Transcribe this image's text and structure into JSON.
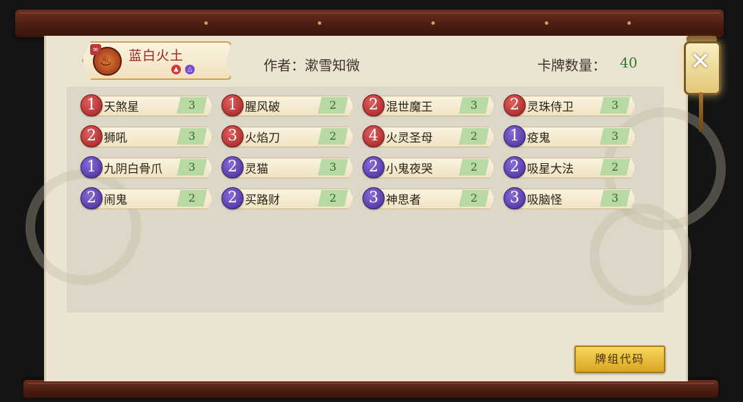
{
  "deck": {
    "name": "蓝白火土",
    "emblem": "fire-spirit-emblem",
    "elements": [
      "fire-icon",
      "earth-icon"
    ],
    "element_colors": [
      "#d23a3a",
      "#7a4ad0"
    ]
  },
  "author": {
    "label": "作者：漱雪知微"
  },
  "card_count": {
    "label": "卡牌数量：",
    "value": "40"
  },
  "cards": [
    {
      "cost": "1",
      "color": "red",
      "name": "天煞星",
      "qty": "3"
    },
    {
      "cost": "1",
      "color": "red",
      "name": "腥风破",
      "qty": "2"
    },
    {
      "cost": "2",
      "color": "red",
      "name": "混世魔王",
      "qty": "3"
    },
    {
      "cost": "2",
      "color": "red",
      "name": "灵珠侍卫",
      "qty": "3"
    },
    {
      "cost": "2",
      "color": "red",
      "name": "狮吼",
      "qty": "3"
    },
    {
      "cost": "3",
      "color": "red",
      "name": "火焰刀",
      "qty": "2"
    },
    {
      "cost": "4",
      "color": "red",
      "name": "火灵圣母",
      "qty": "2"
    },
    {
      "cost": "1",
      "color": "purple",
      "name": "疫鬼",
      "qty": "3"
    },
    {
      "cost": "1",
      "color": "purple",
      "name": "九阴白骨爪",
      "qty": "3"
    },
    {
      "cost": "2",
      "color": "purple",
      "name": "灵猫",
      "qty": "3"
    },
    {
      "cost": "2",
      "color": "purple",
      "name": "小鬼夜哭",
      "qty": "2"
    },
    {
      "cost": "2",
      "color": "purple",
      "name": "吸星大法",
      "qty": "2"
    },
    {
      "cost": "2",
      "color": "purple",
      "name": "闹鬼",
      "qty": "2"
    },
    {
      "cost": "2",
      "color": "purple",
      "name": "买路财",
      "qty": "2"
    },
    {
      "cost": "3",
      "color": "purple",
      "name": "神思者",
      "qty": "2"
    },
    {
      "cost": "3",
      "color": "purple",
      "name": "吸脑怪",
      "qty": "3"
    }
  ],
  "deck_code_button": "牌组代码",
  "close_icon": "close-icon"
}
